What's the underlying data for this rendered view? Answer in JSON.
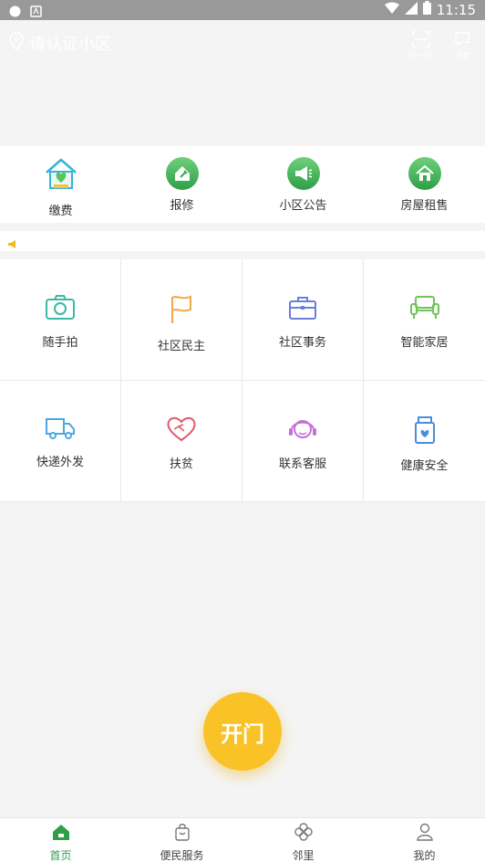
{
  "status_bar": {
    "time": "11:15"
  },
  "header": {
    "location_text": "请认证小区",
    "scan_label": "扫一扫",
    "message_label": "消息"
  },
  "quick_actions": [
    {
      "label": "缴费",
      "icon": "house-heart-icon"
    },
    {
      "label": "报修",
      "icon": "repair-icon"
    },
    {
      "label": "小区公告",
      "icon": "megaphone-icon"
    },
    {
      "label": "房屋租售",
      "icon": "house-icon"
    }
  ],
  "notice_bar": {
    "icon": "announcement-icon"
  },
  "services": [
    {
      "label": "随手拍",
      "icon": "camera-icon",
      "color": "#3bb8a6"
    },
    {
      "label": "社区民主",
      "icon": "flag-icon",
      "color": "#f0a847"
    },
    {
      "label": "社区事务",
      "icon": "briefcase-icon",
      "color": "#6a7fd6"
    },
    {
      "label": "智能家居",
      "icon": "sofa-icon",
      "color": "#6fc45a"
    },
    {
      "label": "快递外发",
      "icon": "truck-icon",
      "color": "#4aa8e0"
    },
    {
      "label": "扶贫",
      "icon": "heart-hand-icon",
      "color": "#e05a6a"
    },
    {
      "label": "联系客服",
      "icon": "headset-icon",
      "color": "#c66fd8"
    },
    {
      "label": "健康安全",
      "icon": "jar-icon",
      "color": "#4a8ed8"
    }
  ],
  "open_door_label": "开门",
  "tabs": [
    {
      "label": "首页",
      "icon": "home-icon",
      "active": true
    },
    {
      "label": "便民服务",
      "icon": "bag-icon",
      "active": false
    },
    {
      "label": "邻里",
      "icon": "clover-icon",
      "active": false
    },
    {
      "label": "我的",
      "icon": "user-icon",
      "active": false
    }
  ],
  "colors": {
    "brand_green": "#2f9e48",
    "door_yellow": "#f9c328"
  }
}
